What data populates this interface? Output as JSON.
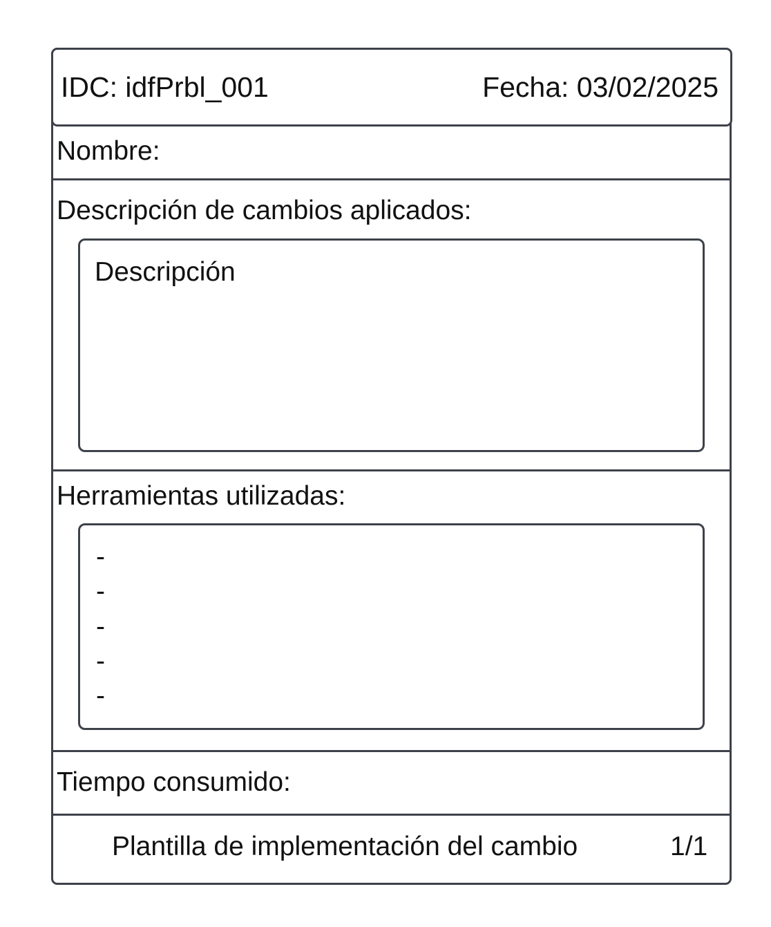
{
  "header": {
    "idc": "IDC: idfPrbl_001",
    "fecha": "Fecha: 03/02/2025"
  },
  "fields": {
    "nombre_label": "Nombre:",
    "descripcion_label": "Descripción de cambios aplicados:",
    "descripcion_placeholder": "Descripción",
    "herramientas_label": "Herramientas utilizadas:",
    "herramientas_items": [
      "-",
      "-",
      "-",
      "-",
      "-"
    ],
    "tiempo_label": "Tiempo consumido:"
  },
  "footer": {
    "title": "Plantilla de implementación del cambio",
    "page": "1/1"
  },
  "colors": {
    "border": "#3d4149",
    "text": "#111111",
    "background": "#ffffff"
  }
}
